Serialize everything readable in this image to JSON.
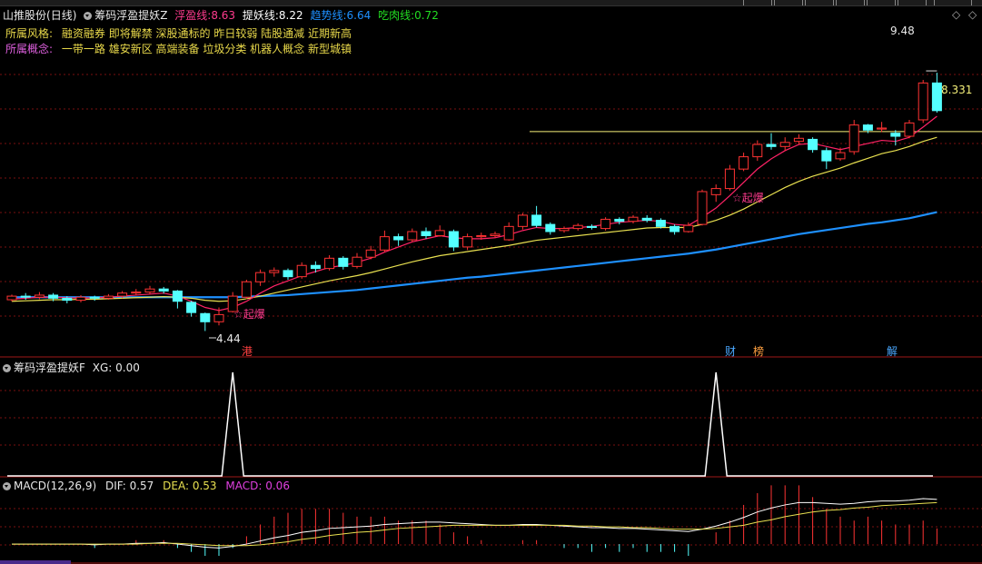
{
  "stock": {
    "name": "山推股份",
    "period": "(日线)"
  },
  "main_indicator": {
    "name": "筹码浮盈提妖Z",
    "lines": [
      {
        "label": "浮盈线:",
        "value": "8.63",
        "color": "#ff3b8e"
      },
      {
        "label": "提妖线:",
        "value": "8.22",
        "color": "#ffffff"
      },
      {
        "label": "趋势线:",
        "value": "6.64",
        "color": "#1e90ff"
      },
      {
        "label": "吃肉线:",
        "value": "0.72",
        "color": "#22dd22"
      }
    ]
  },
  "info": {
    "style_label": "所属风格:",
    "style_text": "融资融券 即将解禁 深股通标的 昨日较弱 陆股通减 近期新高",
    "concept_label": "所属概念:",
    "concept_text": "一带一路 雄安新区 高端装备 垃圾分类 机器人概念 新型城镇"
  },
  "annotations": {
    "high_label": "9.48",
    "low_label": "4.44",
    "price_line_label": "8.331",
    "signal_1": "☆起爆",
    "signal_2": "☆起爆",
    "tag_gang": "港",
    "tag_cai": "财",
    "tag_bang": "榜",
    "tag_jie": "解"
  },
  "sub1": {
    "name": "筹码浮盈提妖F",
    "xg_label": "XG:",
    "xg_value": "0.00"
  },
  "sub2": {
    "name": "MACD(12,26,9)",
    "dif_label": "DIF:",
    "dif_value": "0.57",
    "dea_label": "DEA:",
    "dea_value": "0.53",
    "macd_label": "MACD:",
    "macd_value": "0.06"
  },
  "colors": {
    "up": "#ff3333",
    "down": "#54ffff",
    "ma_fast": "#ff2266",
    "ma_slow": "#e8e050",
    "trend": "#1e90ff",
    "grid": "#7a1010",
    "price_line": "#f5f07a",
    "tag_gang": "#ff4040",
    "tag_cai": "#4aa8ff",
    "tag_bang": "#ffa040",
    "tag_jie": "#4aa8ff"
  },
  "chart_data": [
    {
      "type": "candlestick",
      "title": "山推股份 (日线)",
      "ylim": [
        4.2,
        9.8
      ],
      "candles": [
        [
          5.05,
          5.12,
          5.15,
          5.02
        ],
        [
          5.12,
          5.1,
          5.18,
          5.05
        ],
        [
          5.1,
          5.14,
          5.2,
          5.06
        ],
        [
          5.14,
          5.08,
          5.18,
          5.02
        ],
        [
          5.08,
          5.04,
          5.12,
          4.98
        ],
        [
          5.04,
          5.1,
          5.14,
          5.0
        ],
        [
          5.1,
          5.08,
          5.13,
          5.03
        ],
        [
          5.08,
          5.12,
          5.16,
          5.05
        ],
        [
          5.12,
          5.18,
          5.22,
          5.08
        ],
        [
          5.18,
          5.2,
          5.26,
          5.13
        ],
        [
          5.2,
          5.26,
          5.32,
          5.16
        ],
        [
          5.26,
          5.22,
          5.3,
          5.17
        ],
        [
          5.22,
          5.02,
          5.24,
          4.88
        ],
        [
          5.0,
          4.8,
          5.03,
          4.72
        ],
        [
          4.78,
          4.62,
          4.8,
          4.44
        ],
        [
          4.62,
          4.76,
          4.9,
          4.55
        ],
        [
          4.82,
          5.12,
          5.2,
          4.8
        ],
        [
          5.1,
          5.4,
          5.44,
          5.06
        ],
        [
          5.4,
          5.58,
          5.64,
          5.32
        ],
        [
          5.58,
          5.62,
          5.68,
          5.5
        ],
        [
          5.62,
          5.5,
          5.66,
          5.44
        ],
        [
          5.5,
          5.72,
          5.78,
          5.46
        ],
        [
          5.72,
          5.66,
          5.8,
          5.58
        ],
        [
          5.66,
          5.86,
          5.92,
          5.62
        ],
        [
          5.86,
          5.7,
          5.9,
          5.64
        ],
        [
          5.7,
          5.88,
          5.96,
          5.66
        ],
        [
          5.88,
          6.02,
          6.1,
          5.84
        ],
        [
          6.02,
          6.28,
          6.4,
          5.98
        ],
        [
          6.28,
          6.22,
          6.34,
          6.1
        ],
        [
          6.22,
          6.38,
          6.44,
          6.18
        ],
        [
          6.38,
          6.3,
          6.46,
          6.24
        ],
        [
          6.3,
          6.4,
          6.5,
          6.28
        ],
        [
          6.38,
          6.08,
          6.42,
          6.0
        ],
        [
          6.08,
          6.28,
          6.34,
          6.02
        ],
        [
          6.28,
          6.3,
          6.36,
          6.22
        ],
        [
          6.3,
          6.33,
          6.38,
          6.26
        ],
        [
          6.22,
          6.48,
          6.56,
          6.2
        ],
        [
          6.48,
          6.7,
          6.74,
          6.42
        ],
        [
          6.7,
          6.5,
          6.88,
          6.46
        ],
        [
          6.52,
          6.38,
          6.56,
          6.32
        ],
        [
          6.4,
          6.44,
          6.48,
          6.36
        ],
        [
          6.44,
          6.5,
          6.54,
          6.4
        ],
        [
          6.48,
          6.46,
          6.52,
          6.42
        ],
        [
          6.44,
          6.62,
          6.66,
          6.4
        ],
        [
          6.62,
          6.58,
          6.66,
          6.52
        ],
        [
          6.58,
          6.66,
          6.7,
          6.54
        ],
        [
          6.64,
          6.6,
          6.7,
          6.56
        ],
        [
          6.6,
          6.48,
          6.64,
          6.44
        ],
        [
          6.48,
          6.38,
          6.52,
          6.32
        ],
        [
          6.38,
          6.5,
          6.56,
          6.36
        ],
        [
          6.52,
          7.16,
          7.2,
          6.5
        ],
        [
          7.1,
          7.22,
          7.3,
          6.96
        ],
        [
          7.22,
          7.6,
          7.68,
          7.18
        ],
        [
          7.6,
          7.84,
          7.92,
          7.56
        ],
        [
          7.84,
          8.08,
          8.16,
          7.76
        ],
        [
          8.08,
          8.04,
          8.3,
          7.98
        ],
        [
          8.04,
          8.12,
          8.22,
          7.96
        ],
        [
          8.14,
          8.2,
          8.28,
          8.08
        ],
        [
          8.18,
          7.98,
          8.22,
          7.92
        ],
        [
          7.96,
          7.76,
          8.02,
          7.6
        ],
        [
          7.8,
          7.92,
          8.02,
          7.76
        ],
        [
          7.94,
          8.46,
          8.56,
          7.88
        ],
        [
          8.46,
          8.36,
          8.48,
          8.3
        ],
        [
          8.38,
          8.4,
          8.52,
          8.32
        ],
        [
          8.3,
          8.24,
          8.36,
          8.06
        ],
        [
          8.24,
          8.5,
          8.56,
          8.2
        ],
        [
          8.56,
          9.28,
          9.34,
          8.5
        ],
        [
          9.28,
          8.74,
          9.48,
          8.7
        ]
      ],
      "ma_fast": [
        5.06,
        5.08,
        5.1,
        5.1,
        5.09,
        5.08,
        5.09,
        5.1,
        5.12,
        5.14,
        5.16,
        5.18,
        5.12,
        5.02,
        4.9,
        4.84,
        4.9,
        5.02,
        5.18,
        5.32,
        5.42,
        5.52,
        5.6,
        5.68,
        5.72,
        5.78,
        5.86,
        5.98,
        6.08,
        6.18,
        6.24,
        6.3,
        6.26,
        6.24,
        6.24,
        6.26,
        6.32,
        6.4,
        6.46,
        6.44,
        6.44,
        6.46,
        6.48,
        6.52,
        6.56,
        6.58,
        6.6,
        6.58,
        6.52,
        6.5,
        6.66,
        6.84,
        7.08,
        7.34,
        7.6,
        7.8,
        7.96,
        8.08,
        8.1,
        8.04,
        7.98,
        8.04,
        8.1,
        8.16,
        8.14,
        8.22,
        8.42,
        8.63
      ],
      "ma_slow": [
        5.02,
        5.03,
        5.04,
        5.05,
        5.05,
        5.06,
        5.06,
        5.07,
        5.08,
        5.09,
        5.1,
        5.11,
        5.1,
        5.08,
        5.04,
        5.02,
        5.03,
        5.07,
        5.12,
        5.18,
        5.24,
        5.3,
        5.36,
        5.42,
        5.47,
        5.52,
        5.58,
        5.65,
        5.72,
        5.79,
        5.85,
        5.91,
        5.95,
        5.99,
        6.03,
        6.07,
        6.11,
        6.16,
        6.21,
        6.24,
        6.27,
        6.3,
        6.33,
        6.36,
        6.39,
        6.42,
        6.45,
        6.46,
        6.46,
        6.46,
        6.52,
        6.6,
        6.7,
        6.82,
        6.96,
        7.1,
        7.24,
        7.36,
        7.46,
        7.54,
        7.62,
        7.72,
        7.81,
        7.9,
        7.96,
        8.04,
        8.14,
        8.22
      ],
      "trend": [
        5.1,
        5.1,
        5.1,
        5.1,
        5.1,
        5.1,
        5.1,
        5.1,
        5.1,
        5.1,
        5.1,
        5.1,
        5.1,
        5.1,
        5.1,
        5.1,
        5.1,
        5.11,
        5.12,
        5.13,
        5.14,
        5.16,
        5.18,
        5.2,
        5.22,
        5.24,
        5.27,
        5.3,
        5.33,
        5.36,
        5.39,
        5.42,
        5.45,
        5.48,
        5.5,
        5.53,
        5.56,
        5.59,
        5.62,
        5.65,
        5.68,
        5.71,
        5.74,
        5.77,
        5.8,
        5.83,
        5.86,
        5.89,
        5.92,
        5.95,
        5.99,
        6.03,
        6.08,
        6.13,
        6.18,
        6.23,
        6.28,
        6.33,
        6.37,
        6.41,
        6.45,
        6.49,
        6.53,
        6.56,
        6.6,
        6.64,
        6.7,
        6.76
      ],
      "price_line": 8.331
    },
    {
      "type": "line",
      "title": "筹码浮盈提妖F",
      "ylim": [
        0,
        1
      ],
      "spike_indices": [
        16,
        51
      ],
      "series": [
        {
          "name": "XG",
          "values": []
        }
      ]
    },
    {
      "type": "bar",
      "title": "MACD(12,26,9)",
      "ylim": [
        -0.15,
        0.65
      ],
      "dif": [
        0.0,
        0.0,
        0.0,
        0.0,
        0.0,
        0.0,
        -0.01,
        0.0,
        0.0,
        0.01,
        0.01,
        0.02,
        0.0,
        -0.02,
        -0.04,
        -0.05,
        -0.03,
        0.0,
        0.04,
        0.08,
        0.11,
        0.15,
        0.17,
        0.2,
        0.21,
        0.22,
        0.23,
        0.25,
        0.26,
        0.27,
        0.28,
        0.28,
        0.27,
        0.26,
        0.25,
        0.24,
        0.24,
        0.25,
        0.25,
        0.24,
        0.23,
        0.22,
        0.21,
        0.21,
        0.2,
        0.2,
        0.19,
        0.18,
        0.17,
        0.16,
        0.19,
        0.23,
        0.28,
        0.34,
        0.41,
        0.46,
        0.5,
        0.53,
        0.53,
        0.52,
        0.51,
        0.52,
        0.54,
        0.55,
        0.55,
        0.56,
        0.58,
        0.57
      ],
      "dea": [
        0.0,
        0.0,
        0.0,
        0.0,
        0.0,
        0.0,
        0.0,
        0.0,
        0.0,
        0.0,
        0.01,
        0.01,
        0.01,
        0.0,
        -0.01,
        -0.02,
        -0.02,
        -0.02,
        -0.01,
        0.01,
        0.03,
        0.06,
        0.08,
        0.11,
        0.13,
        0.15,
        0.16,
        0.18,
        0.2,
        0.21,
        0.22,
        0.23,
        0.24,
        0.24,
        0.24,
        0.24,
        0.24,
        0.24,
        0.24,
        0.24,
        0.24,
        0.23,
        0.23,
        0.22,
        0.22,
        0.21,
        0.21,
        0.2,
        0.19,
        0.19,
        0.19,
        0.2,
        0.22,
        0.24,
        0.28,
        0.31,
        0.35,
        0.38,
        0.41,
        0.43,
        0.44,
        0.46,
        0.47,
        0.49,
        0.5,
        0.51,
        0.52,
        0.53
      ]
    }
  ]
}
